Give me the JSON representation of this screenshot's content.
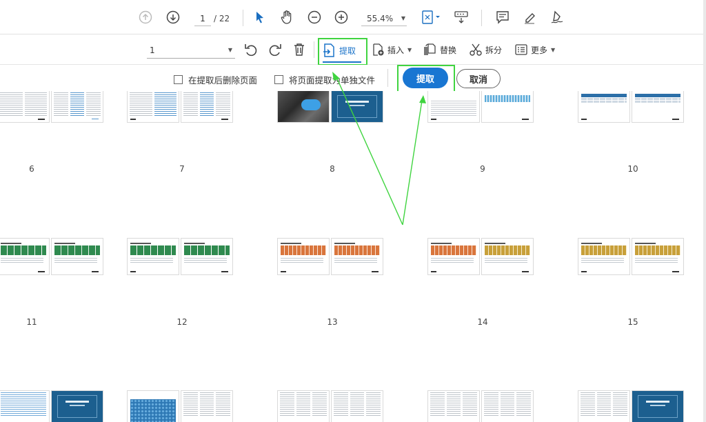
{
  "toolbar": {
    "page_current": "1",
    "page_total": "/ 22",
    "zoom": "55.4%",
    "icons": [
      "prev-page-icon",
      "next-page-icon",
      "select-cursor-icon",
      "hand-tool-icon",
      "zoom-out-icon",
      "zoom-in-icon",
      "fit-page-icon",
      "scroll-mode-icon",
      "comment-icon",
      "highlight-icon",
      "sign-icon"
    ]
  },
  "organize_toolbar": {
    "page_range": "1",
    "extract_label": "提取",
    "insert_label": "插入",
    "replace_label": "替换",
    "split_label": "拆分",
    "more_label": "更多"
  },
  "extract_options": {
    "delete_after_label": "在提取后删除页面",
    "separate_files_label": "将页面提取为单独文件",
    "extract_button": "提取",
    "cancel_button": "取消"
  },
  "pages": {
    "row1_numbers": [
      "6",
      "7",
      "8",
      "9",
      "10"
    ],
    "row2_numbers": [
      "11",
      "12",
      "13",
      "14",
      "15"
    ]
  },
  "colors": {
    "accent": "#1976d2",
    "highlight": "#3fd43f",
    "navy": "#1c5f8f",
    "green_table": "#2f8a4f",
    "orange_table": "#d9753c",
    "gold_table": "#c8a03a"
  }
}
